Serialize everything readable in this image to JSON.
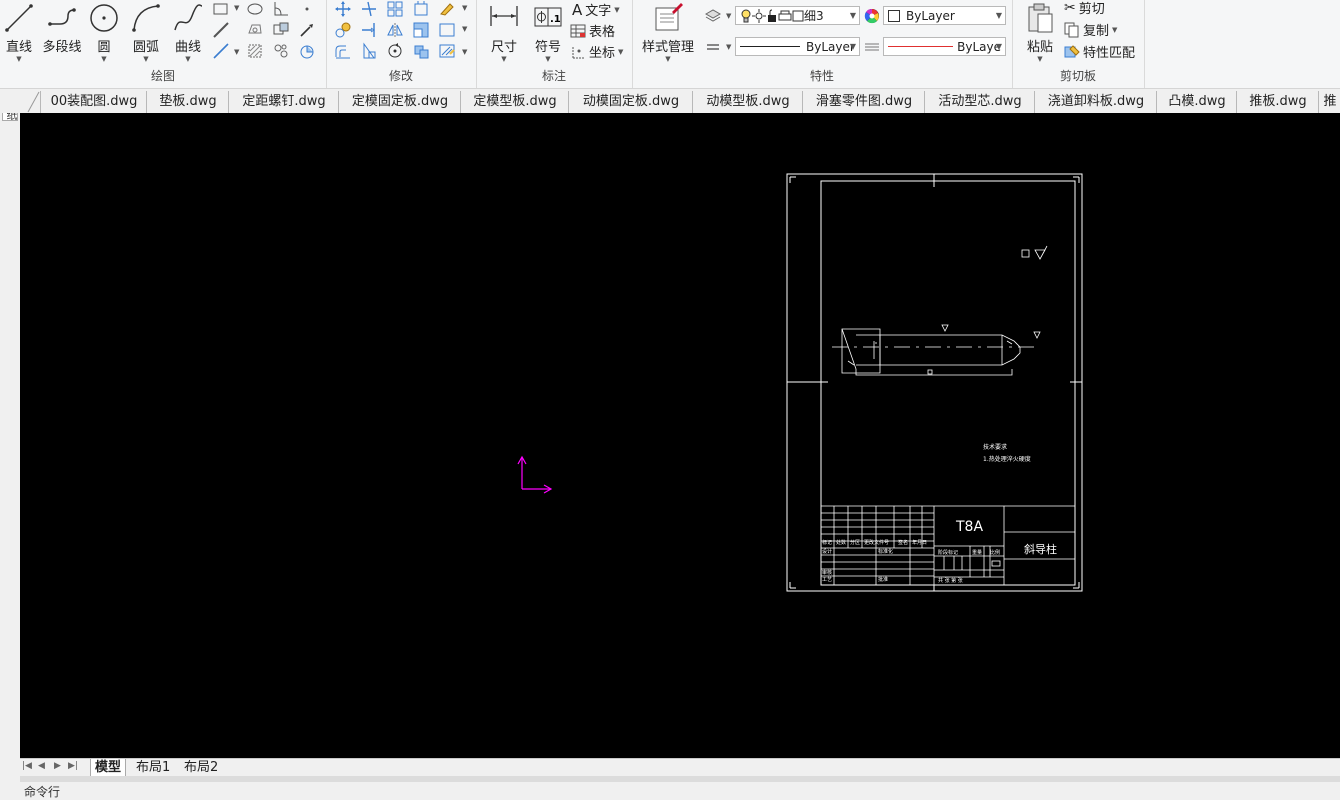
{
  "ribbon": {
    "draw": {
      "title": "绘图",
      "line": "直线",
      "polyline": "多段线",
      "circle": "圆",
      "arc": "圆弧",
      "curve": "曲线"
    },
    "modify": {
      "title": "修改"
    },
    "annotate": {
      "title": "标注",
      "dimension": "尺寸",
      "symbol": "符号",
      "text": "文字",
      "table": "表格",
      "coordinate": "坐标"
    },
    "properties": {
      "title": "特性",
      "style_manager": "样式管理",
      "layer_combo": "细3",
      "color_combo": "ByLayer",
      "linetype_combo": "ByLayer",
      "lineweight_combo": "ByLaye"
    },
    "clipboard": {
      "title": "剪切板",
      "paste": "粘贴",
      "cut": "剪切",
      "copy": "复制",
      "match": "特性匹配"
    }
  },
  "left_strip": {
    "label": "图纸"
  },
  "doc_tabs": [
    "00装配图.dwg",
    "垫板.dwg",
    "定距螺钉.dwg",
    "定模固定板.dwg",
    "定模型板.dwg",
    "动模固定板.dwg",
    "动模型板.dwg",
    "滑塞零件图.dwg",
    "活动型芯.dwg",
    "浇道卸料板.dwg",
    "凸模.dwg",
    "推板.dwg",
    "推"
  ],
  "drawing": {
    "material": "T8A",
    "part_name": "斜导柱",
    "tech_req_title": "技术要求",
    "tech_req_1": "1.热处理淬火硬度",
    "tb_row_labels": [
      "标记",
      "处数",
      "分区",
      "更改文件号",
      "签名",
      "年月日"
    ],
    "tb_design": "设计",
    "tb_standard": "标准化",
    "tb_review": "审核",
    "tb_process": "工艺",
    "tb_approve": "批准",
    "tb_stage": "阶段标记",
    "tb_weight": "重量",
    "tb_scale": "比例",
    "tb_sheets": "共   张 第   张"
  },
  "layout_tabs": [
    "模型",
    "布局1",
    "布局2"
  ],
  "command_line": "命令行",
  "colors": {
    "canvas": "#000000",
    "ucs": "#ff00ff",
    "linetype_red": "#e03030"
  }
}
